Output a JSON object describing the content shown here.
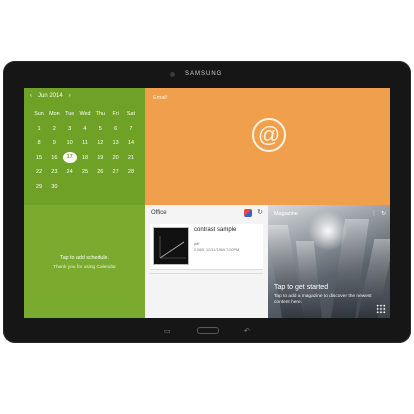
{
  "device": {
    "brand": "SAMSUNG"
  },
  "calendar": {
    "month_label": "Jun 2014",
    "prev_icon": "chevron-left-icon",
    "next_icon": "chevron-right-icon",
    "weekdays": [
      "Sun",
      "Mon",
      "Tue",
      "Wed",
      "Thu",
      "Fri",
      "Sat"
    ],
    "weeks": [
      [
        "1",
        "2",
        "3",
        "4",
        "5",
        "6",
        "7"
      ],
      [
        "8",
        "9",
        "10",
        "11",
        "12",
        "13",
        "14"
      ],
      [
        "15",
        "16",
        "17",
        "18",
        "19",
        "20",
        "21"
      ],
      [
        "22",
        "23",
        "24",
        "25",
        "26",
        "27",
        "28"
      ],
      [
        "29",
        "30",
        "",
        "",
        "",
        "",
        ""
      ]
    ],
    "today": "17",
    "add_schedule": "Tap to add schedule.",
    "thanks": "Thank you for using Calendar",
    "accent": "#6ea125"
  },
  "email": {
    "label": "Email",
    "icon": "at-icon",
    "accent": "#f0a04c"
  },
  "office": {
    "label": "Office",
    "document": {
      "title": "contrast sample",
      "type": "pdf",
      "meta": "0.06B, 12/31/1969 7:00PM"
    }
  },
  "magazine": {
    "label": "Magazine",
    "title": "Tap to get started",
    "text": "Tap to add a magazine to discover the newest content here."
  },
  "navigation": {
    "home_icon": "home-button",
    "recent_icon": "recent-apps-icon",
    "back_icon": "back-icon"
  }
}
